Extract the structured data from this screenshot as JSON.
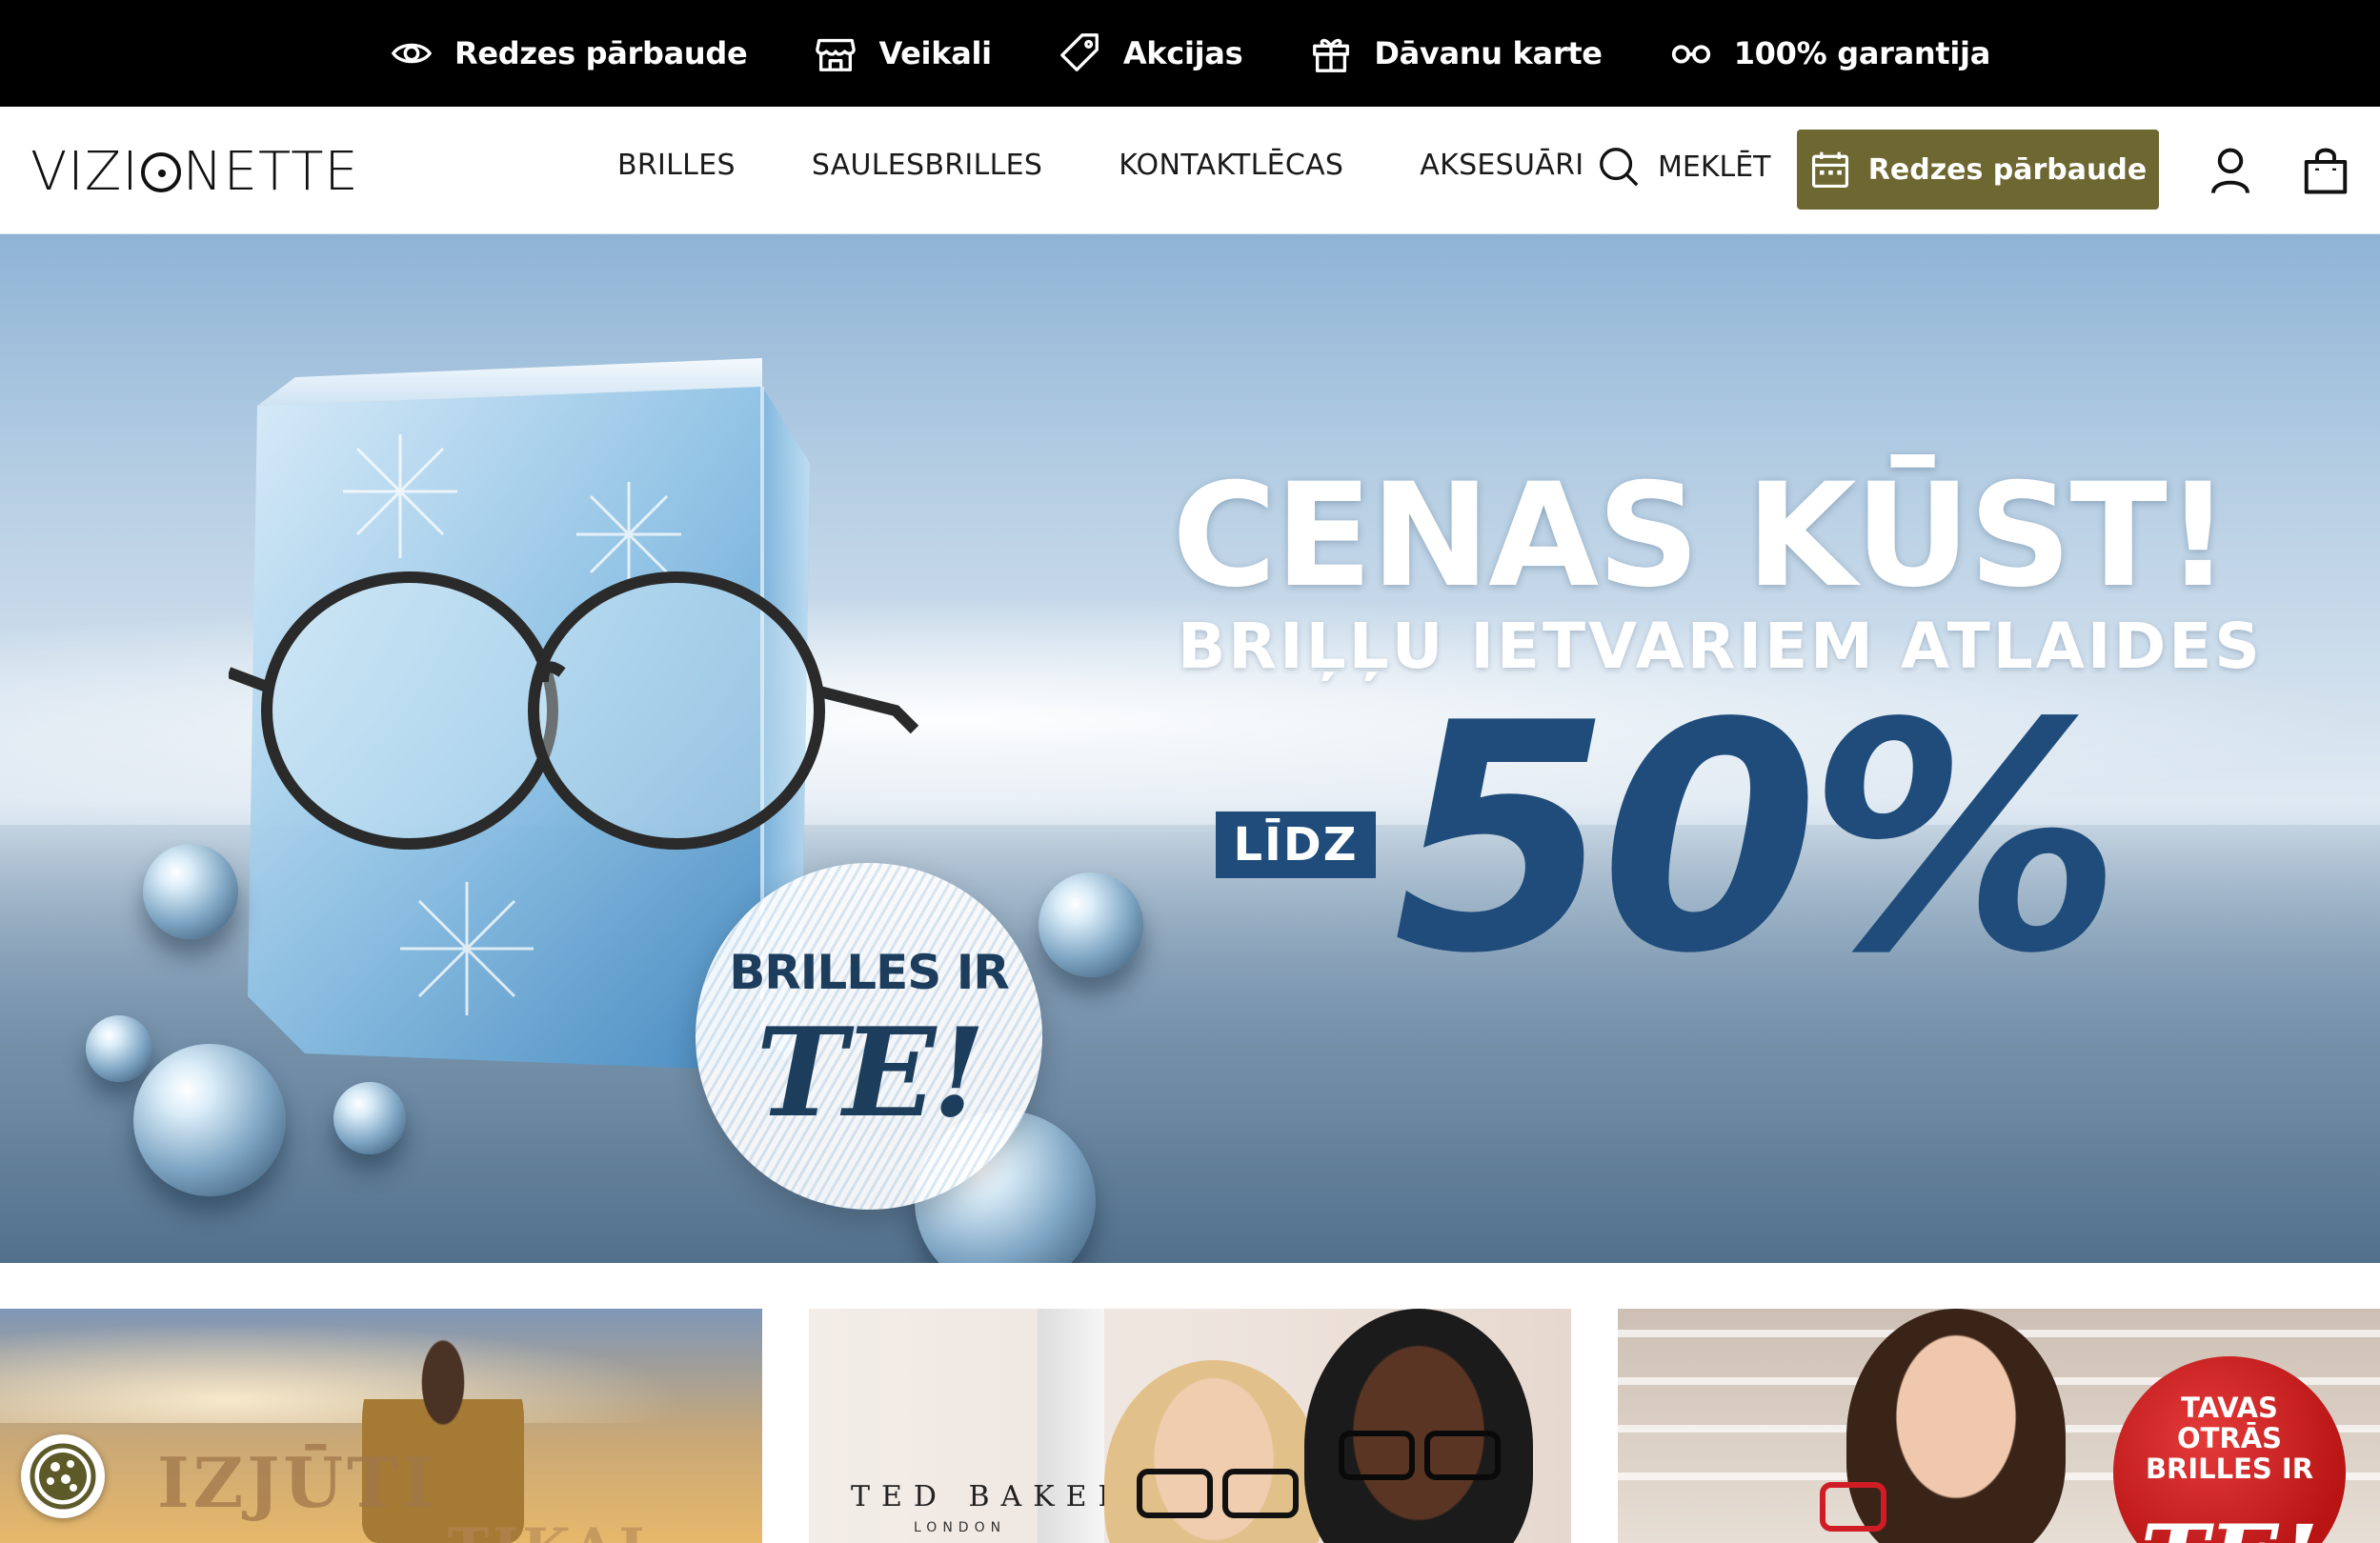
{
  "topbar": {
    "items": [
      {
        "label": "Redzes pārbaude",
        "icon": "eye-icon"
      },
      {
        "label": "Veikali",
        "icon": "store-icon"
      },
      {
        "label": "Akcijas",
        "icon": "tag-icon"
      },
      {
        "label": "Dāvanu karte",
        "icon": "gift-icon"
      },
      {
        "label": "100% garantija",
        "icon": "glasses-icon"
      }
    ]
  },
  "header": {
    "logo": {
      "prefix": "VIZI",
      "suffix": "NETTE"
    },
    "nav": [
      "BRILLES",
      "SAULESBRILLES",
      "KONTAKTLĒCAS",
      "AKSESUĀRI"
    ],
    "search_label": "MEKLĒT",
    "cta_label": "Redzes pārbaude",
    "cta_color": "#6d6731",
    "icons": [
      "user-icon",
      "shopping-bag-icon"
    ]
  },
  "hero": {
    "title": "CENAS KŪST!",
    "subtitle": "BRIĻĻU IETVARIEM ATLAIDES",
    "lidz": "LĪDZ",
    "discount": "50%",
    "badge_line1": "BRILLES IR",
    "badge_line2": "TE!",
    "accent_color": "#1f4c7a"
  },
  "cards": {
    "card1": {
      "text1": "IZJŪTI",
      "text2": "TIKAI"
    },
    "card2": {
      "brand": "TED BAKER",
      "brand_sub": "LONDON"
    },
    "card3": {
      "badge_line1": "TAVAS",
      "badge_line2": "OTRĀS",
      "badge_line3": "BRILLES IR",
      "badge_line4": "TE!"
    }
  },
  "cookie_icon": "cookie-icon"
}
